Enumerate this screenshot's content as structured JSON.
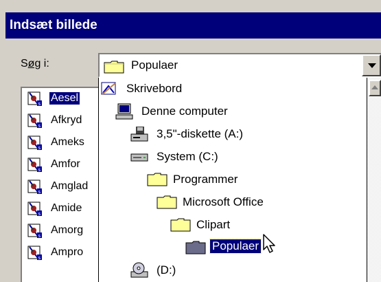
{
  "window": {
    "title": "Indsæt billede"
  },
  "lookin": {
    "label_pre": "S",
    "label_u": "øg",
    "label_post": " i:",
    "value": "Populaer",
    "icon": "folder-icon"
  },
  "colors": {
    "titlebar": "#00007b",
    "selection": "#00007b",
    "face": "#d4d0c8"
  },
  "files": [
    {
      "name": "Aesel",
      "selected": true
    },
    {
      "name": "Afkryd",
      "selected": false
    },
    {
      "name": "Ameks",
      "selected": false
    },
    {
      "name": "Amfor",
      "selected": false
    },
    {
      "name": "Amglad",
      "selected": false
    },
    {
      "name": "Amide",
      "selected": false
    },
    {
      "name": "Amorg",
      "selected": false
    },
    {
      "name": "Ampro",
      "selected": false
    }
  ],
  "locations": [
    {
      "label": "Skrivebord",
      "icon": "desktop-icon"
    },
    {
      "label": "Denne computer",
      "icon": "computer-icon"
    },
    {
      "label": "3,5\"-diskette (A:)",
      "icon": "floppy-drive-icon"
    },
    {
      "label": "System (C:)",
      "icon": "hard-drive-icon"
    },
    {
      "label": "Programmer",
      "icon": "folder-icon"
    },
    {
      "label": "Microsoft Office",
      "icon": "folder-icon"
    },
    {
      "label": "Clipart",
      "icon": "folder-icon"
    },
    {
      "label": "Populaer",
      "icon": "open-folder-icon",
      "selected": true
    },
    {
      "label": "(D:)",
      "icon": "cd-drive-icon"
    }
  ]
}
